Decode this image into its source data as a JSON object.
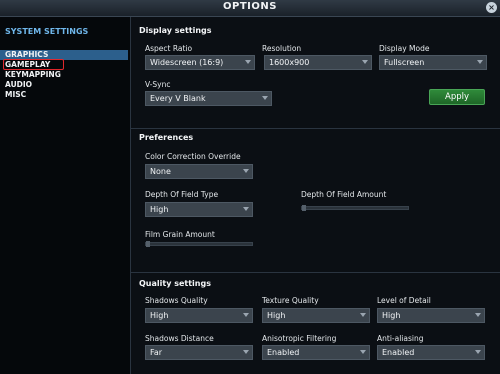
{
  "window": {
    "title": "OPTIONS",
    "close_glyph": "×"
  },
  "sidebar": {
    "title": "SYSTEM SETTINGS",
    "items": [
      "GRAPHICS",
      "GAMEPLAY",
      "KEYMAPPING",
      "AUDIO",
      "MISC"
    ],
    "selected": "GRAPHICS",
    "annotated_item": "GAMEPLAY"
  },
  "display": {
    "heading": "Display settings",
    "aspect_ratio_label": "Aspect Ratio",
    "aspect_ratio_value": "Widescreen (16:9)",
    "resolution_label": "Resolution",
    "resolution_value": "1600x900",
    "display_mode_label": "Display Mode",
    "display_mode_value": "Fullscreen",
    "vsync_label": "V-Sync",
    "vsync_value": "Every V Blank",
    "apply_label": "Apply"
  },
  "preferences": {
    "heading": "Preferences",
    "color_correction_label": "Color Correction Override",
    "color_correction_value": "None",
    "dof_type_label": "Depth Of Field Type",
    "dof_type_value": "High",
    "dof_amount_label": "Depth Of Field Amount",
    "film_grain_label": "Film Grain Amount"
  },
  "quality": {
    "heading": "Quality settings",
    "shadows_quality_label": "Shadows Quality",
    "shadows_quality_value": "High",
    "texture_quality_label": "Texture Quality",
    "texture_quality_value": "High",
    "lod_label": "Level of Detail",
    "lod_value": "High",
    "shadows_distance_label": "Shadows Distance",
    "shadows_distance_value": "Far",
    "aniso_label": "Anisotropic Filtering",
    "aniso_value": "Enabled",
    "aa_label": "Anti-aliasing",
    "aa_value": "Enabled"
  },
  "colors": {
    "accent": "#6fb6ea",
    "selected_bg": "#2c5f8c",
    "annotation": "#e0282d",
    "apply": "#2f8a3a"
  }
}
